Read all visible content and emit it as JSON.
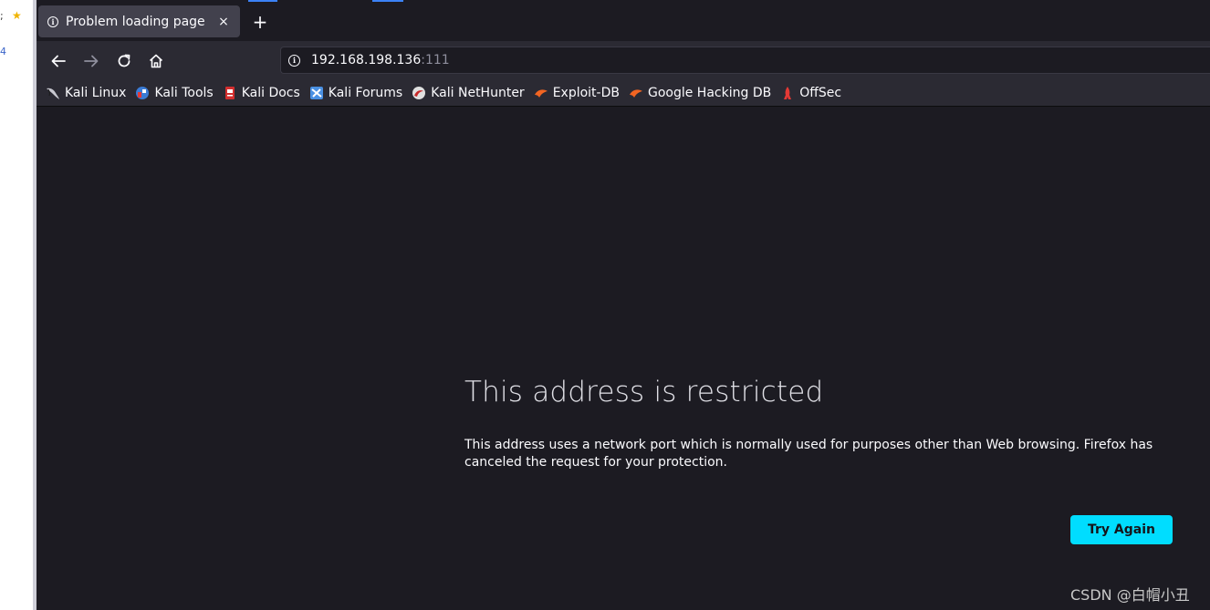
{
  "external": {
    "fragment_text": "; ",
    "fragment_text2": "4"
  },
  "tab": {
    "title": "Problem loading page",
    "close": "×"
  },
  "new_tab": "+",
  "url": {
    "host": "192.168.198.136",
    "port": ":111"
  },
  "bookmarks": [
    {
      "label": "Kali Linux",
      "icon": "kali-dragon-icon"
    },
    {
      "label": "Kali Tools",
      "icon": "kali-tools-icon"
    },
    {
      "label": "Kali Docs",
      "icon": "kali-docs-icon"
    },
    {
      "label": "Kali Forums",
      "icon": "kali-forums-icon"
    },
    {
      "label": "Kali NetHunter",
      "icon": "kali-nethunter-icon"
    },
    {
      "label": "Exploit-DB",
      "icon": "exploit-db-icon"
    },
    {
      "label": "Google Hacking DB",
      "icon": "ghdb-icon"
    },
    {
      "label": "OffSec",
      "icon": "offsec-icon"
    }
  ],
  "error": {
    "title": "This address is restricted",
    "description": "This address uses a network port which is normally used for purposes other than Web browsing. Firefox has canceled the request for your protection.",
    "button": "Try Again"
  },
  "watermark": "CSDN @白帽小丑",
  "colors": {
    "background": "#1c1b22",
    "toolbar": "#2b2a33",
    "button_accent": "#00ddff"
  }
}
